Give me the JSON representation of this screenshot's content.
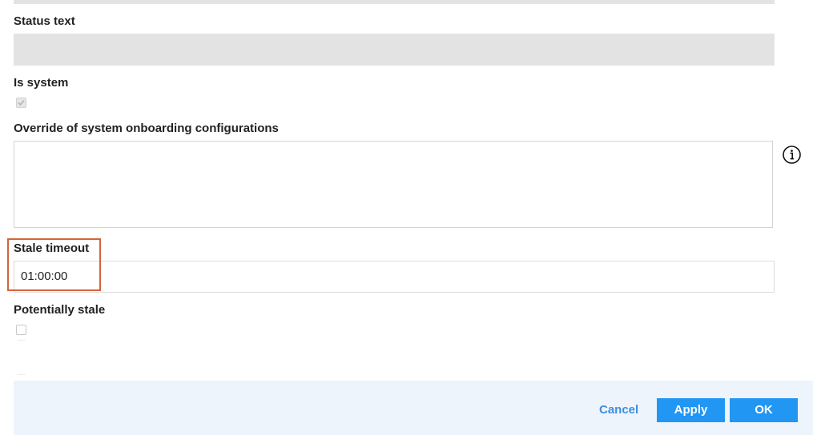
{
  "form": {
    "status_text": {
      "label": "Status text",
      "value": ""
    },
    "is_system": {
      "label": "Is system",
      "checked": true,
      "disabled": true
    },
    "override": {
      "label": "Override of system onboarding configurations",
      "value": "",
      "info_icon": "info-icon"
    },
    "stale_timeout": {
      "label": "Stale timeout",
      "value": "01:00:00"
    },
    "potentially_stale": {
      "label": "Potentially stale",
      "checked": false
    }
  },
  "footer": {
    "cancel_label": "Cancel",
    "apply_label": "Apply",
    "ok_label": "OK"
  },
  "colors": {
    "accent": "#2196f3",
    "link": "#3d8ee0",
    "highlight_border": "#d2643c",
    "readonly_background": "#e3e3e3",
    "footer_background": "#eef4fc"
  }
}
